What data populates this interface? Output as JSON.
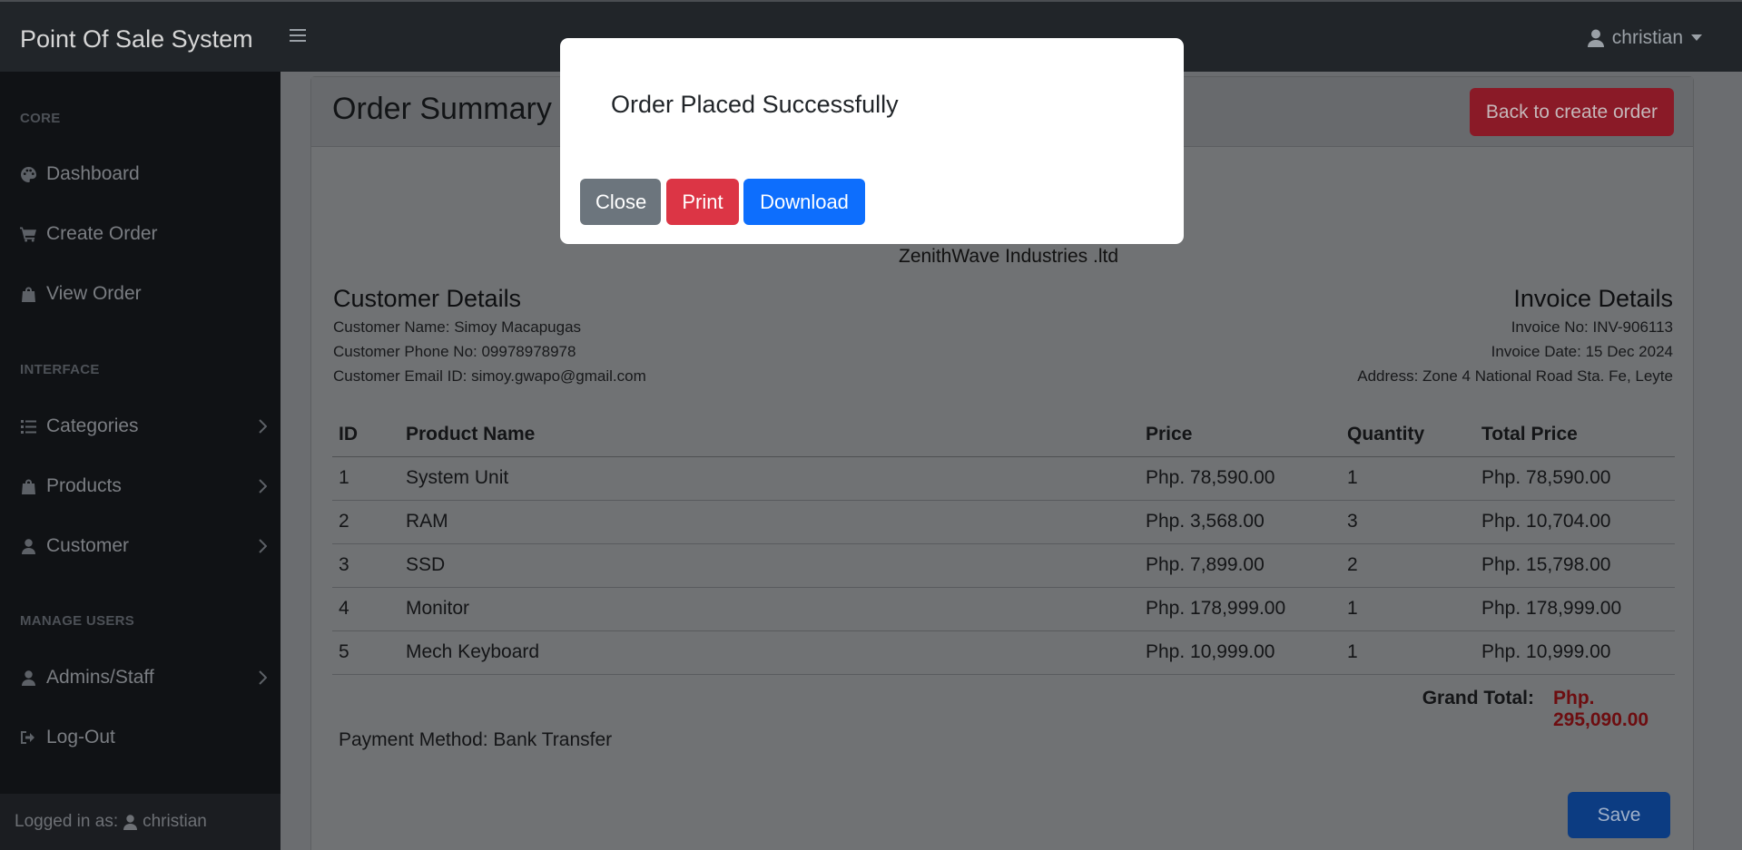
{
  "app": {
    "brand": "Point Of Sale System",
    "user_name": "christian"
  },
  "sidebar": {
    "sections": {
      "core": "CORE",
      "interface": "INTERFACE",
      "manage_users": "MANAGE USERS"
    },
    "items": [
      {
        "label": "Dashboard",
        "icon": "palette-icon"
      },
      {
        "label": "Create Order",
        "icon": "cart-icon"
      },
      {
        "label": "View Order",
        "icon": "bag-icon"
      },
      {
        "label": "Categories",
        "icon": "list-icon"
      },
      {
        "label": "Products",
        "icon": "bag-icon"
      },
      {
        "label": "Customer",
        "icon": "user-icon"
      },
      {
        "label": "Admins/Staff",
        "icon": "users-icon"
      },
      {
        "label": "Log-Out",
        "icon": "logout-icon"
      }
    ],
    "footer_prefix": "Logged in as:",
    "footer_user": "christian"
  },
  "page": {
    "title": "Order Summary",
    "back_button": "Back to create order",
    "company": "ZenithWave Industries .ltd",
    "customer": {
      "heading": "Customer Details",
      "name": "Customer Name: Simoy Macapugas",
      "phone": "Customer Phone No: 09978978978",
      "email": "Customer Email ID: simoy.gwapo@gmail.com"
    },
    "invoice": {
      "heading": "Invoice Details",
      "number": "Invoice No: INV-906113",
      "date": "Invoice Date: 15 Dec 2024",
      "address": "Address: Zone 4 National Road Sta. Fe, Leyte"
    },
    "table": {
      "headers": [
        "ID",
        "Product Name",
        "Price",
        "Quantity",
        "Total Price"
      ],
      "rows": [
        [
          "1",
          "System Unit",
          "Php. 78,590.00",
          "1",
          "Php. 78,590.00"
        ],
        [
          "2",
          "RAM",
          "Php. 3,568.00",
          "3",
          "Php. 10,704.00"
        ],
        [
          "3",
          "SSD",
          "Php. 7,899.00",
          "2",
          "Php. 15,798.00"
        ],
        [
          "4",
          "Monitor",
          "Php. 178,999.00",
          "1",
          "Php. 178,999.00"
        ],
        [
          "5",
          "Mech Keyboard",
          "Php. 10,999.00",
          "1",
          "Php. 10,999.00"
        ]
      ]
    },
    "grand_total_label": "Grand Total:",
    "grand_total_value": "Php. 295,090.00",
    "payment_method": "Payment Method: Bank Transfer",
    "save_button": "Save"
  },
  "modal": {
    "title": "Order Placed Successfully",
    "close": "Close",
    "print": "Print",
    "download": "Download"
  },
  "colors": {
    "navbar": "#212529",
    "sidebar": "#101215",
    "danger": "#dc3545",
    "primary": "#0d6efd",
    "secondary": "#6c757d"
  }
}
